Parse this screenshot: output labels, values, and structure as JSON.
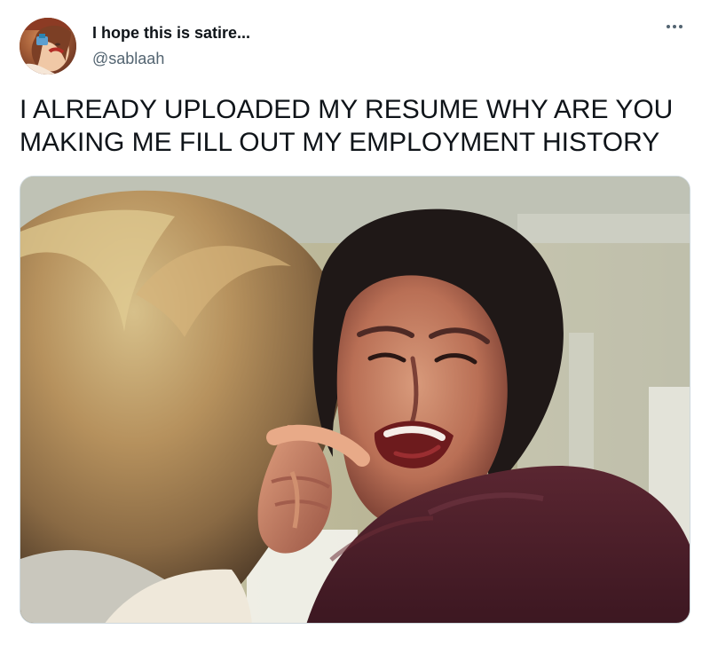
{
  "tweet": {
    "author": {
      "display_name": "I hope this is satire...",
      "handle": "@sablaah",
      "avatar_icon": "profile-avatar-icon"
    },
    "more_icon": "more-options-icon",
    "text": "I ALREADY UPLOADED MY RESUME WHY ARE YOU MAKING ME FILL OUT MY EMPLOYMENT HISTORY",
    "media": {
      "description_icon": "movie-still-image-icon"
    },
    "colors": {
      "text_primary": "#0f1419",
      "text_secondary": "#536471",
      "background": "#ffffff"
    }
  }
}
